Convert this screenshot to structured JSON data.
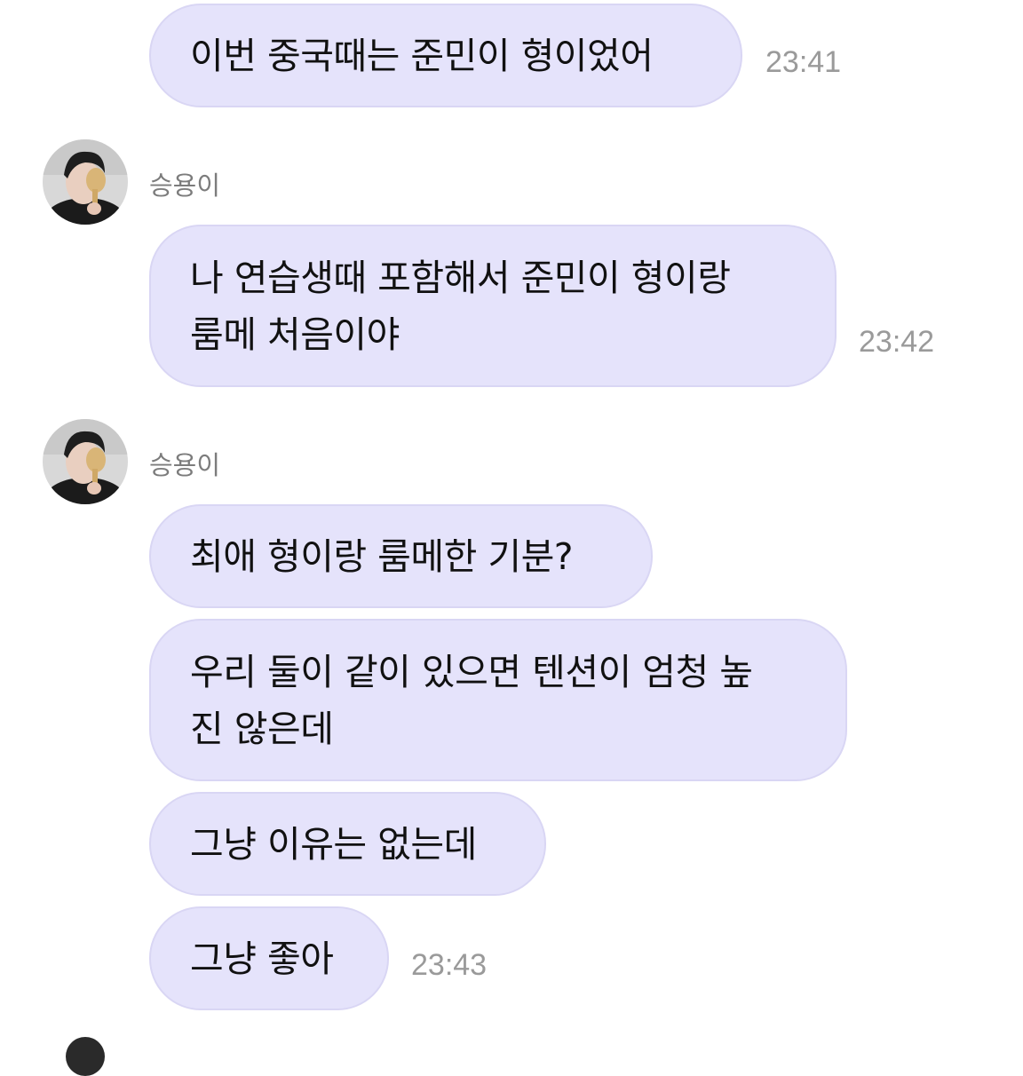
{
  "chat": {
    "messages": [
      {
        "lines": [
          "이번 중국때는 준민이 형이었어"
        ],
        "time": "23:41"
      },
      {
        "sender": "승용이",
        "lines": [
          "나 연습생때 포함해서 준민이 형이랑",
          "룸메 처음이야"
        ],
        "time": "23:42"
      },
      {
        "sender": "승용이",
        "lines": [
          "최애 형이랑 룸메한 기분?"
        ]
      },
      {
        "lines": [
          "우리 둘이 같이 있으면 텐션이 엄청 높",
          "진 않은데"
        ]
      },
      {
        "lines": [
          "그냥 이유는 없는데"
        ]
      },
      {
        "lines": [
          "그냥 좋아"
        ],
        "time": "23:43"
      }
    ]
  },
  "colors": {
    "bubble_bg": "#e5e3fb",
    "bubble_border": "#d9d6f4",
    "time_text": "#9a9a9a",
    "sender_text": "#7c7c7c"
  }
}
